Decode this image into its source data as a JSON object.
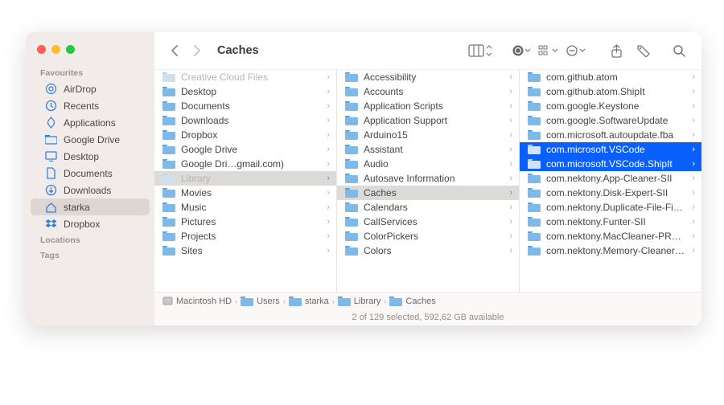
{
  "window": {
    "title": "Caches"
  },
  "sidebar": {
    "sections": [
      {
        "label": "Favourites",
        "items": [
          {
            "icon": "airdrop",
            "label": "AirDrop"
          },
          {
            "icon": "clock",
            "label": "Recents"
          },
          {
            "icon": "apps",
            "label": "Applications"
          },
          {
            "icon": "folder",
            "label": "Google Drive"
          },
          {
            "icon": "desktop",
            "label": "Desktop"
          },
          {
            "icon": "doc",
            "label": "Documents"
          },
          {
            "icon": "download",
            "label": "Downloads"
          },
          {
            "icon": "home",
            "label": "starka",
            "selected": true
          },
          {
            "icon": "dropbox",
            "label": "Dropbox"
          }
        ]
      },
      {
        "label": "Locations",
        "items": []
      },
      {
        "label": "Tags",
        "items": []
      }
    ]
  },
  "columns": [
    [
      {
        "label": "Creative Cloud Files",
        "dim": true
      },
      {
        "label": "Desktop"
      },
      {
        "label": "Documents"
      },
      {
        "label": "Downloads"
      },
      {
        "label": "Dropbox"
      },
      {
        "label": "Google Drive"
      },
      {
        "label": "Google Dri…gmail.com)"
      },
      {
        "label": "Library",
        "dim": true,
        "active": true
      },
      {
        "label": "Movies"
      },
      {
        "label": "Music"
      },
      {
        "label": "Pictures"
      },
      {
        "label": "Projects"
      },
      {
        "label": "Sites"
      }
    ],
    [
      {
        "label": "Accessibility"
      },
      {
        "label": "Accounts"
      },
      {
        "label": "Application Scripts"
      },
      {
        "label": "Application Support"
      },
      {
        "label": "Arduino15"
      },
      {
        "label": "Assistant"
      },
      {
        "label": "Audio"
      },
      {
        "label": "Autosave Information"
      },
      {
        "label": "Caches",
        "active": true
      },
      {
        "label": "Calendars"
      },
      {
        "label": "CallServices"
      },
      {
        "label": "ColorPickers"
      },
      {
        "label": "Colors"
      }
    ],
    [
      {
        "label": "com.github.atom"
      },
      {
        "label": "com.github.atom.ShipIt"
      },
      {
        "label": "com.google.Keystone"
      },
      {
        "label": "com.google.SoftwareUpdate"
      },
      {
        "label": "com.microsoft.autoupdate.fba"
      },
      {
        "label": "com.microsoft.VSCode",
        "selected": true
      },
      {
        "label": "com.microsoft.VSCode.ShipIt",
        "selected": true
      },
      {
        "label": "com.nektony.App-Cleaner-SII"
      },
      {
        "label": "com.nektony.Disk-Expert-SII"
      },
      {
        "label": "com.nektony.Duplicate-File-Finder-SII"
      },
      {
        "label": "com.nektony.Funter-SII"
      },
      {
        "label": "com.nektony.MacCleaner-PRO-SII"
      },
      {
        "label": "com.nektony.Memory-Cleaner-SII"
      }
    ]
  ],
  "path": [
    "Macintosh HD",
    "Users",
    "starka",
    "Library",
    "Caches"
  ],
  "status": "2 of 129 selected, 592,62 GB available"
}
